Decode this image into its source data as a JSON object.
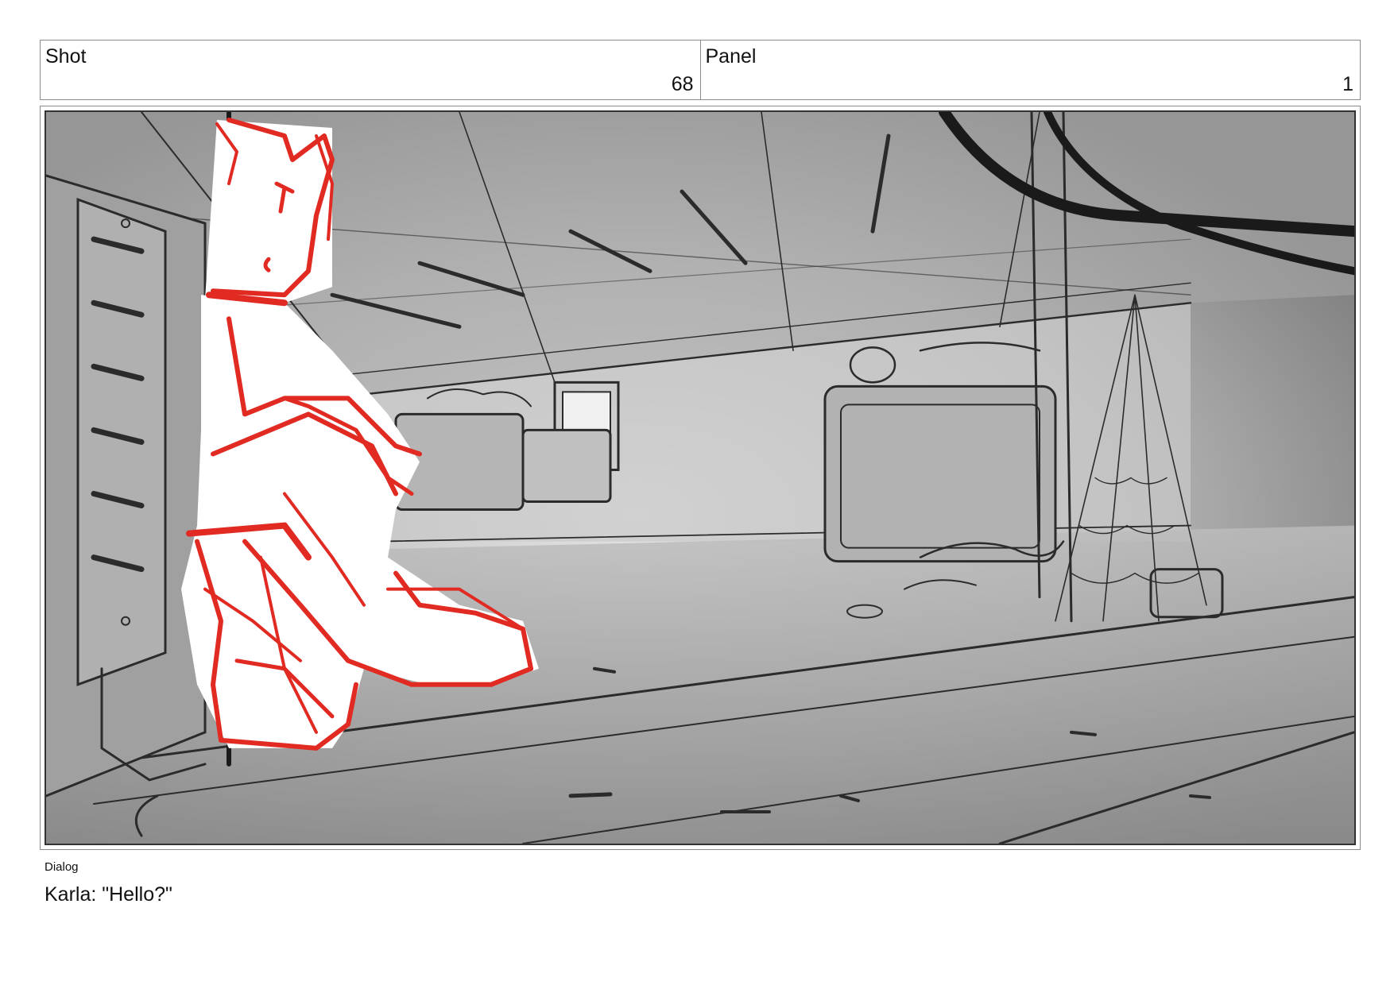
{
  "header": {
    "shot_label": "Shot",
    "shot_value": "68",
    "panel_label": "Panel",
    "panel_value": "1"
  },
  "panel_image": {
    "icon": "storyboard-sketch-image",
    "sketch_color": "#e02a22"
  },
  "dialog": {
    "label": "Dialog",
    "text": "Karla: \"Hello?\""
  }
}
